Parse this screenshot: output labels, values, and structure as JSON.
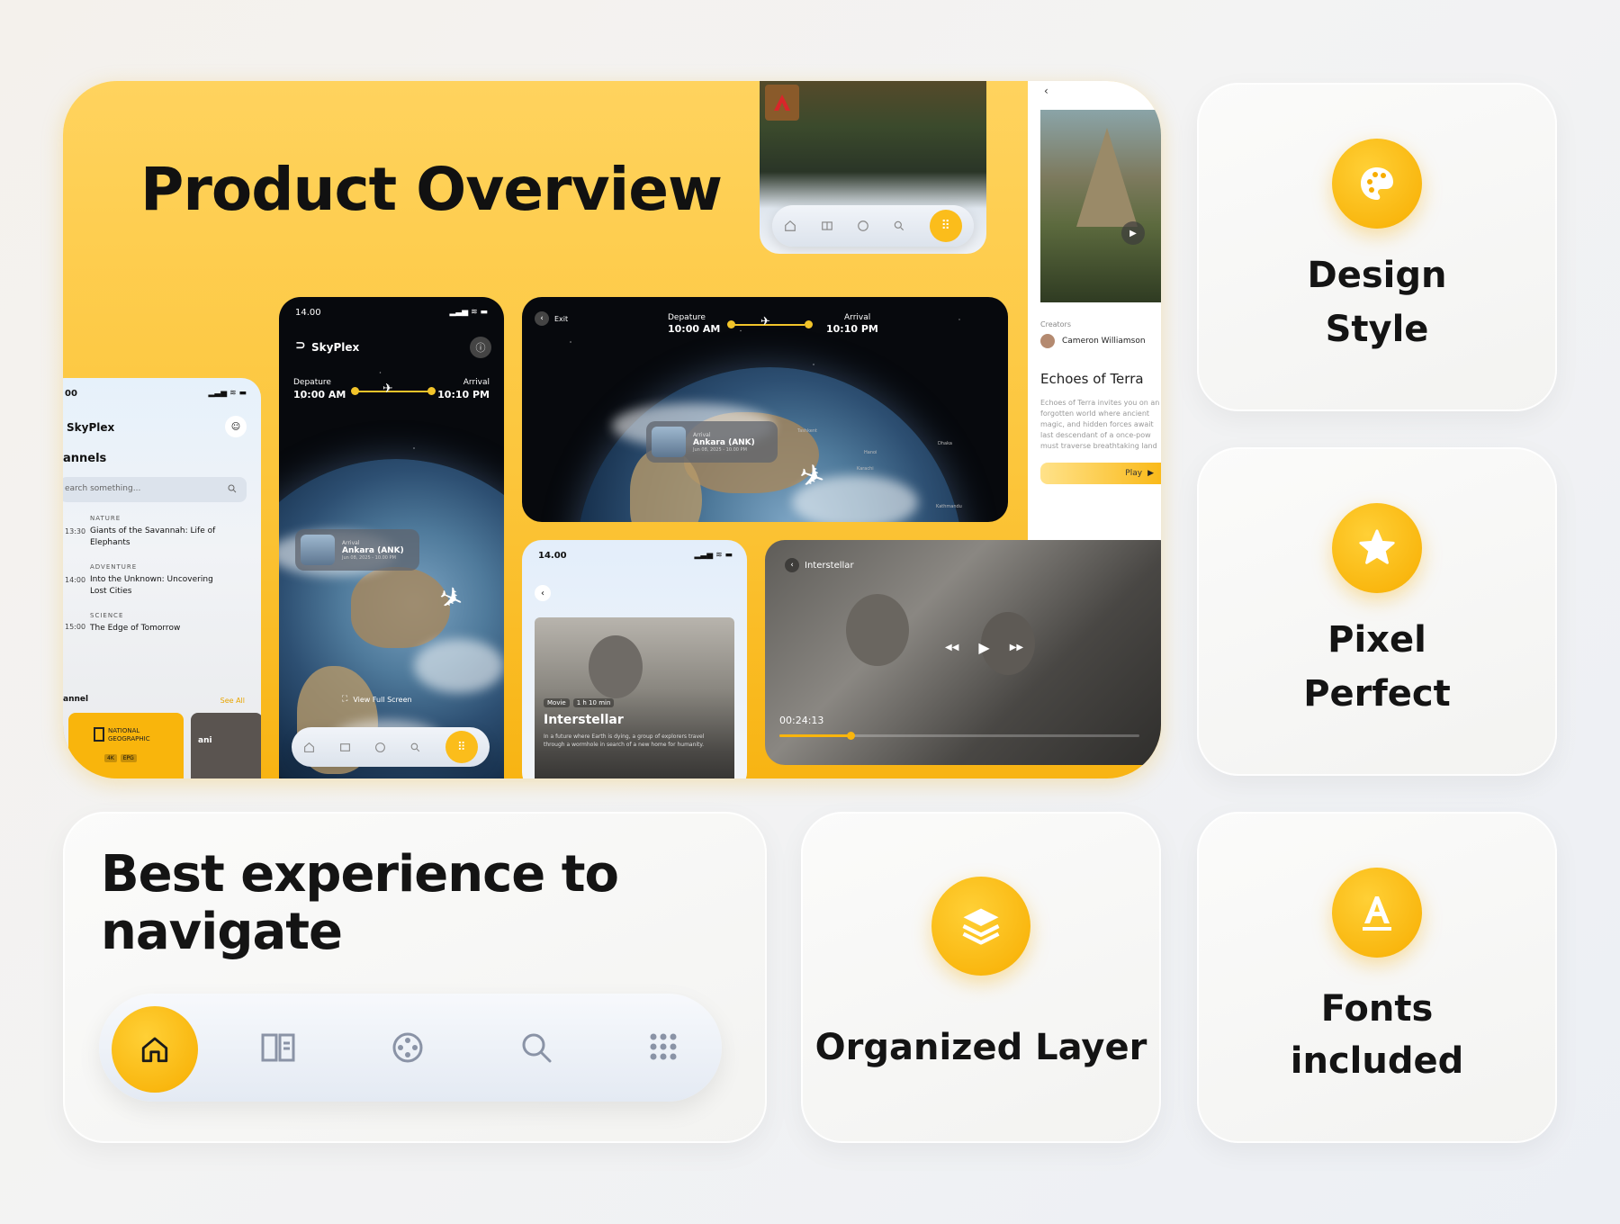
{
  "hero": {
    "title": "Product Overview"
  },
  "features": [
    {
      "title_line1": "Design",
      "title_line2": "Style",
      "icon": "palette-icon"
    },
    {
      "title_line1": "Pixel",
      "title_line2": "Perfect",
      "icon": "star-icon"
    },
    {
      "title_line1": "Organized Layer",
      "icon": "layers-icon"
    },
    {
      "title_line1": "Fonts",
      "title_line2": "included",
      "icon": "font-a-icon"
    }
  ],
  "navigate_card": {
    "title_line1": "Best experience to",
    "title_line2": "navigate"
  },
  "bottom_nav": [
    "home-icon",
    "book-icon",
    "film-reel-icon",
    "search-icon",
    "grid-icon"
  ],
  "accent_color": "#f9b50c",
  "phone_channels": {
    "time": "00",
    "brand": "SkyPlex",
    "heading": "annels",
    "search_placeholder": "earch something...",
    "items": [
      {
        "time": "13:30",
        "category": "NATURE",
        "title": "Giants of the Savannah: Life of Elephants"
      },
      {
        "time": "14:00",
        "category": "ADVENTURE",
        "title": "Into the Unknown: Uncovering Lost Cities"
      },
      {
        "time": "15:00",
        "category": "SCIENCE",
        "title": "The Edge of Tomorrow"
      }
    ],
    "section": "annel",
    "see_all": "See All",
    "ng_label": "NATIONAL GEOGRAPHIC",
    "badges": [
      "4K",
      "EPG"
    ],
    "next_label": "ani"
  },
  "phone_flight": {
    "time": "14.00",
    "brand": "SkyPlex",
    "dep_label": "Depature",
    "dep_time": "10:00 AM",
    "arr_label": "Arrival",
    "arr_time": "10:10 PM",
    "card_tag": "Arrival",
    "card_city": "Ankara (ANK)",
    "card_date": "Jun 08, 2025 - 10.00 PM",
    "full_screen": "View Full Screen"
  },
  "tablet_flight": {
    "exit": "Exit",
    "dep_label": "Depature",
    "dep_time": "10:00 AM",
    "arr_label": "Arrival",
    "arr_time": "10:10 PM",
    "card_tag": "Arrival",
    "card_city": "Ankara (ANK)",
    "card_date": "Jun 08, 2025 - 10.00 PM",
    "cities": [
      "Kathmandu",
      "Dhaka",
      "Hanoi",
      "Karachi",
      "Tashkent"
    ]
  },
  "game_detail": {
    "creators_label": "Creators",
    "creator": "Cameron Williamson",
    "title": "Echoes of Terra",
    "description": "Echoes of Terra invites you on an a forgotten world where ancient magic, and hidden forces await last descendant of a once-pow must traverse breathtaking land dense enchanted forests to cru",
    "play": "Play"
  },
  "movie_phone": {
    "time": "14.00",
    "tag1": "Movie",
    "tag2": "1 h 10 min",
    "title": "Interstellar",
    "description": "In a future where Earth is dying, a group of explorers travel through a wormhole in search of a new home for humanity."
  },
  "player": {
    "title": "Interstellar",
    "elapsed": "00:24:13",
    "progress": 0.2
  }
}
